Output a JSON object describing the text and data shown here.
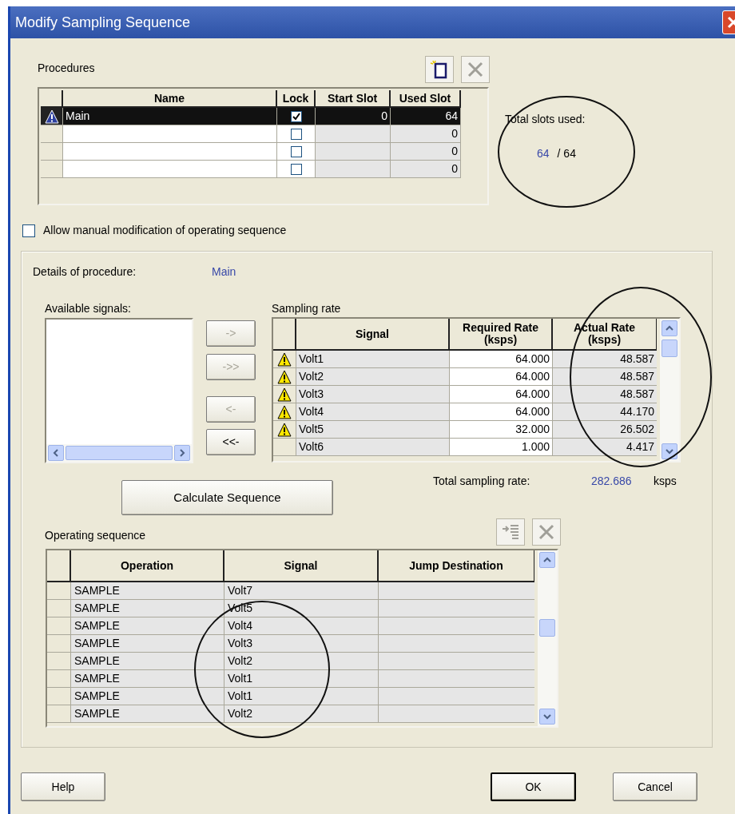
{
  "window": {
    "title": "Modify Sampling Sequence"
  },
  "procedures": {
    "label": "Procedures",
    "columns": [
      "Name",
      "Lock",
      "Start Slot",
      "Used Slot"
    ],
    "rows": [
      {
        "name": "Main",
        "locked": true,
        "start_slot": "0",
        "used_slot": "64",
        "selected": true,
        "warning": true
      },
      {
        "locked": false,
        "used_slot": "0",
        "selected": false,
        "warning": false
      },
      {
        "locked": false,
        "used_slot": "0",
        "selected": false,
        "warning": false
      },
      {
        "locked": false,
        "used_slot": "0",
        "selected": false,
        "warning": false
      }
    ]
  },
  "total_slots": {
    "label": "Total slots used:",
    "used": "64",
    "total": "/ 64"
  },
  "allow_manual": {
    "label": "Allow manual modification of operating sequence",
    "checked": false
  },
  "details": {
    "label": "Details of procedure:",
    "value": "Main"
  },
  "available_signals": {
    "label": "Available signals:"
  },
  "transfer_buttons": [
    {
      "label": "->",
      "disabled": true
    },
    {
      "label": "->>",
      "disabled": true
    },
    {
      "label": "<-",
      "disabled": true
    },
    {
      "label": "<<-",
      "disabled": false
    }
  ],
  "sampling_rate": {
    "label": "Sampling rate",
    "columns": [
      "Signal",
      "Required Rate (ksps)",
      "Actual Rate (ksps)"
    ],
    "rows": [
      {
        "signal": "Volt1",
        "required": "64.000",
        "actual": "48.587",
        "warning": true
      },
      {
        "signal": "Volt2",
        "required": "64.000",
        "actual": "48.587",
        "warning": true
      },
      {
        "signal": "Volt3",
        "required": "64.000",
        "actual": "48.587",
        "warning": true
      },
      {
        "signal": "Volt4",
        "required": "64.000",
        "actual": "44.170",
        "warning": true
      },
      {
        "signal": "Volt5",
        "required": "32.000",
        "actual": "26.502",
        "warning": true
      },
      {
        "signal": "Volt6",
        "required": "1.000",
        "actual": "4.417",
        "warning": false
      }
    ]
  },
  "total_sampling_rate": {
    "label": "Total sampling rate:",
    "value": "282.686",
    "unit": "ksps"
  },
  "calculate_button": {
    "label": "Calculate Sequence"
  },
  "operating_sequence": {
    "label": "Operating sequence",
    "columns": [
      "Operation",
      "Signal",
      "Jump Destination"
    ],
    "rows": [
      {
        "operation": "SAMPLE",
        "signal": "Volt7"
      },
      {
        "operation": "SAMPLE",
        "signal": "Volt5"
      },
      {
        "operation": "SAMPLE",
        "signal": "Volt4"
      },
      {
        "operation": "SAMPLE",
        "signal": "Volt3"
      },
      {
        "operation": "SAMPLE",
        "signal": "Volt2"
      },
      {
        "operation": "SAMPLE",
        "signal": "Volt1"
      },
      {
        "operation": "SAMPLE",
        "signal": "Volt1"
      },
      {
        "operation": "SAMPLE",
        "signal": "Volt2"
      }
    ]
  },
  "buttons": [
    {
      "label": "Help",
      "default": false
    },
    {
      "label": "OK",
      "default": true
    },
    {
      "label": "Cancel",
      "default": false
    }
  ]
}
